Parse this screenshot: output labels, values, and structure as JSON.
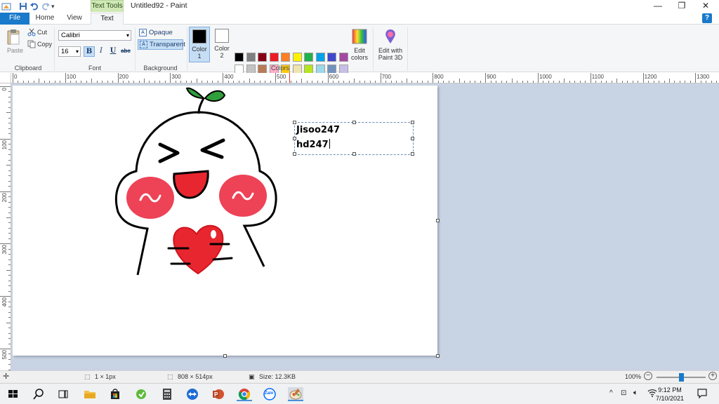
{
  "window": {
    "title": "Untitled92 - Paint",
    "context_tab": "Text Tools",
    "controls": {
      "minimize": "—",
      "maximize": "❐",
      "close": "✕"
    }
  },
  "tabs": [
    {
      "label": "File"
    },
    {
      "label": "Home"
    },
    {
      "label": "View"
    },
    {
      "label": "Text"
    }
  ],
  "ribbon": {
    "clipboard": {
      "paste": "Paste",
      "cut": "Cut",
      "copy": "Copy",
      "group": "Clipboard"
    },
    "font": {
      "family": "Calibri",
      "size": "16",
      "bold": "B",
      "italic": "I",
      "underline": "U",
      "strike": "abc",
      "group": "Font"
    },
    "background": {
      "opaque": "Opaque",
      "transparent": "Transparent",
      "group": "Background"
    },
    "colors": {
      "color1_label_a": "Color",
      "color1_label_b": "1",
      "color2_label_a": "Color",
      "color2_label_b": "2",
      "edit_colors_a": "Edit",
      "edit_colors_b": "colors",
      "edit_paint3d_a": "Edit with",
      "edit_paint3d_b": "Paint 3D",
      "group": "Colors",
      "color1": "#000000",
      "color2": "#ffffff",
      "palette_row1": [
        "#000000",
        "#7f7f7f",
        "#880015",
        "#ed1c24",
        "#ff7f27",
        "#fff200",
        "#22b14c",
        "#00a2e8",
        "#3f48cc",
        "#a349a4"
      ],
      "palette_row2": [
        "#ffffff",
        "#c3c3c3",
        "#b97a57",
        "#ffaec9",
        "#ffc90e",
        "#efe4b0",
        "#b5e61d",
        "#99d9ea",
        "#7092be",
        "#c8bfe7"
      ],
      "palette_row3": [
        "#ffffff",
        "#ffffff",
        "#ffffff",
        "#ffffff",
        "#ffffff",
        "#ffffff",
        "#ffffff",
        "#ffffff",
        "#ffffff",
        "#ffffff"
      ]
    }
  },
  "ruler": {
    "top": [
      "0",
      "100",
      "200",
      "300",
      "400",
      "500",
      "600",
      "700",
      "800",
      "900",
      "1000",
      "1100",
      "1200",
      "1300"
    ],
    "left": [
      "0",
      "100",
      "200",
      "300",
      "400",
      "500"
    ]
  },
  "canvas": {
    "text_lines": [
      "Jisoo247",
      "hd247"
    ]
  },
  "status": {
    "selection": "1 × 1px",
    "canvas_size": "808 × 514px",
    "file_size": "Size: 12.3KB",
    "zoom": "100%",
    "zoom_level": 0.5
  },
  "taskbar": {
    "time": "9:12 PM",
    "date": "7/10/2021",
    "zalo": "Zalo"
  }
}
